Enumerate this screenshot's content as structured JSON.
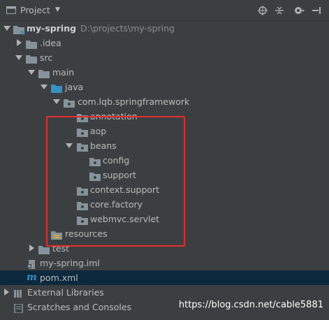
{
  "header": {
    "title": "Project",
    "dropdown_icon": "caret-down-icon"
  },
  "toolbar": [
    "locate-icon",
    "collapse-all-icon",
    "settings-icon",
    "hide-icon"
  ],
  "tree": [
    {
      "label": "my-spring",
      "path": "D:\\projects\\my-spring",
      "expanded": true,
      "icon": "module-folder-icon"
    },
    {
      "label": ".idea",
      "expanded": false,
      "icon": "folder-icon"
    },
    {
      "label": "src",
      "expanded": true,
      "icon": "folder-icon"
    },
    {
      "label": "main",
      "expanded": true,
      "icon": "folder-icon"
    },
    {
      "label": "java",
      "expanded": true,
      "icon": "source-folder-icon"
    },
    {
      "label": "com.lqb.springframework",
      "expanded": true,
      "icon": "package-icon"
    },
    {
      "label": "annotation",
      "icon": "package-icon"
    },
    {
      "label": "aop",
      "icon": "package-icon"
    },
    {
      "label": "beans",
      "expanded": true,
      "icon": "package-icon"
    },
    {
      "label": "config",
      "icon": "package-icon"
    },
    {
      "label": "support",
      "icon": "package-icon"
    },
    {
      "label": "context.support",
      "icon": "package-icon"
    },
    {
      "label": "core.factory",
      "icon": "package-icon"
    },
    {
      "label": "webmvc.servlet",
      "icon": "package-icon"
    },
    {
      "label": "resources",
      "icon": "resources-folder-icon"
    },
    {
      "label": "test",
      "expanded": false,
      "icon": "folder-icon"
    },
    {
      "label": "my-spring.iml",
      "icon": "iml-file-icon"
    },
    {
      "label": "pom.xml",
      "icon": "maven-file-icon",
      "selected": true
    },
    {
      "label": "External Libraries",
      "expanded": false,
      "icon": "libraries-icon"
    },
    {
      "label": "Scratches and Consoles",
      "icon": "scratches-icon"
    }
  ],
  "watermark": "https://blog.csdn.net/cable5881",
  "colors": {
    "background": "#3c3f41",
    "selection": "#0d293e",
    "highlight_box": "#e52d2d",
    "text": "#bbbbbb"
  }
}
